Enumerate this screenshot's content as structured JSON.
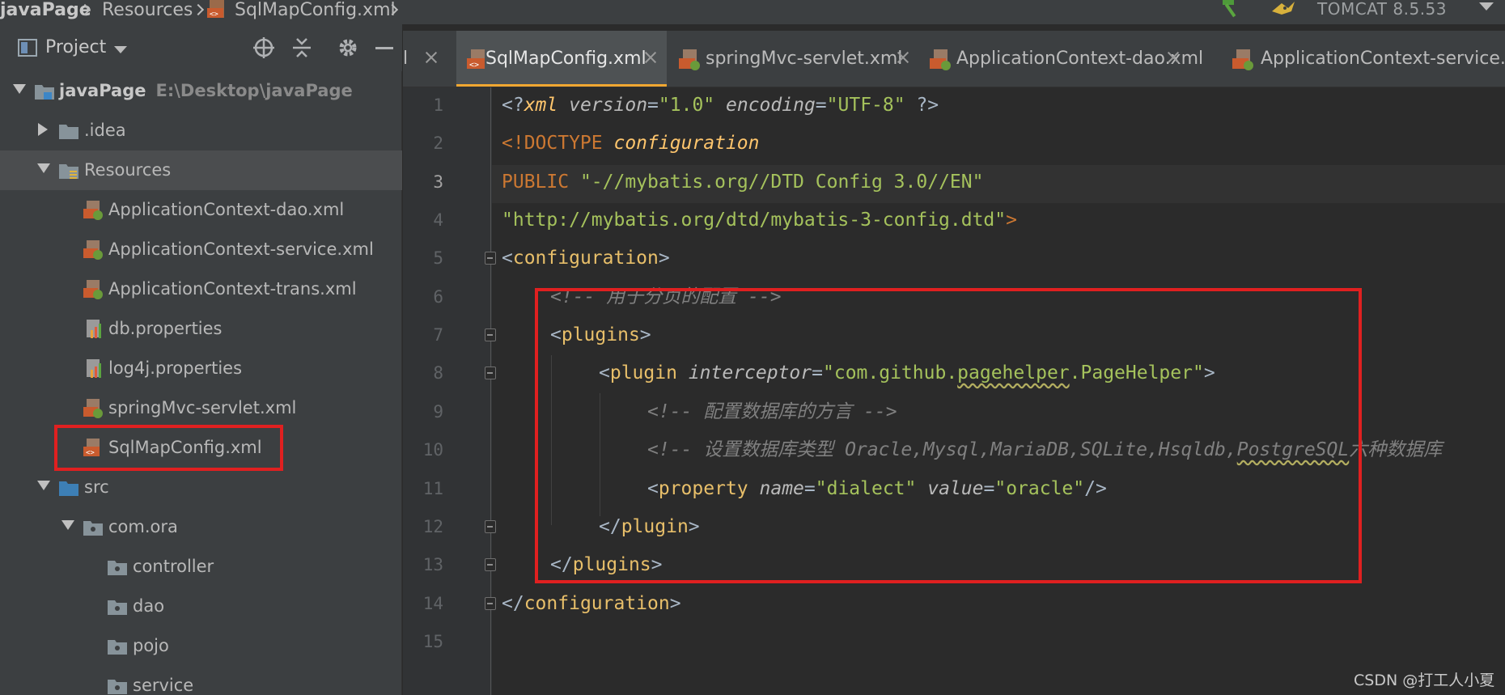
{
  "breadcrumb": {
    "items": [
      "javaPage",
      "Resources",
      "SqlMapConfig.xml"
    ]
  },
  "run_config": {
    "label": "TOMCAT 8.5.53"
  },
  "project_panel": {
    "title": "Project",
    "tree": [
      {
        "label": "javaPage",
        "sub": "E:\\Desktop\\javaPage"
      },
      {
        "label": ".idea"
      },
      {
        "label": "Resources"
      },
      {
        "label": "ApplicationContext-dao.xml"
      },
      {
        "label": "ApplicationContext-service.xml"
      },
      {
        "label": "ApplicationContext-trans.xml"
      },
      {
        "label": "db.properties"
      },
      {
        "label": "log4j.properties"
      },
      {
        "label": "springMvc-servlet.xml"
      },
      {
        "label": "SqlMapConfig.xml"
      },
      {
        "label": "src"
      },
      {
        "label": "com.ora"
      },
      {
        "label": "controller"
      },
      {
        "label": "dao"
      },
      {
        "label": "pojo"
      },
      {
        "label": "service"
      }
    ]
  },
  "tabs": [
    {
      "label": "l"
    },
    {
      "label": "SqlMapConfig.xml"
    },
    {
      "label": "springMvc-servlet.xml"
    },
    {
      "label": "ApplicationContext-dao.xml"
    },
    {
      "label": "ApplicationContext-service.xml"
    }
  ],
  "editor": {
    "line_numbers": [
      "1",
      "2",
      "3",
      "4",
      "5",
      "6",
      "7",
      "8",
      "9",
      "10",
      "11",
      "12",
      "13",
      "14",
      "15"
    ],
    "current_line": 3,
    "code": {
      "l1": {
        "open": "<?",
        "tag": "xml",
        "a1": "version",
        "eq1": "=",
        "v1": "\"1.0\"",
        "a2": "encoding",
        "eq2": "=",
        "v2": "\"UTF-8\"",
        "close": " ?>"
      },
      "l2": {
        "decl": "<!DOCTYPE",
        "name": "configuration"
      },
      "l3": {
        "kw": "PUBLIC",
        "str": "\"-//mybatis.org//DTD Config 3.0//EN\""
      },
      "l4": {
        "str": "\"http://mybatis.org/dtd/mybatis-3-config.dtd\"",
        "end": ">"
      },
      "l5": {
        "lt": "<",
        "tag": "configuration",
        "gt": ">"
      },
      "l6": {
        "comment": "<!-- 用于分页的配置 -->"
      },
      "l7": {
        "lt": "<",
        "tag": "plugins",
        "gt": ">"
      },
      "l8": {
        "lt": "<",
        "tag": "plugin",
        "attr": "interceptor",
        "eq": "=",
        "v_pre": "\"com.github.",
        "v_sq": "pagehelper",
        "v_post": ".PageHelper\"",
        "gt": ">"
      },
      "l9": {
        "comment": "<!-- 配置数据库的方言 -->"
      },
      "l10": {
        "pre": "<!-- 设置数据库类型 Oracle,Mysql,MariaDB,SQLite,Hsqldb,",
        "sq": "PostgreSQL",
        "post": "六种数据库"
      },
      "l11": {
        "lt": "<",
        "tag": "property",
        "a1": "name",
        "eq1": "=",
        "v1": "\"dialect\"",
        "a2": "value",
        "eq2": "=",
        "v2": "\"oracle\"",
        "end": "/>"
      },
      "l12": {
        "lt": "</",
        "tag": "plugin",
        "gt": ">"
      },
      "l13": {
        "lt": "</",
        "tag": "plugins",
        "gt": ">"
      },
      "l14": {
        "lt": "</",
        "tag": "configuration",
        "gt": ">"
      }
    }
  },
  "watermark": "CSDN @打工人小夏"
}
